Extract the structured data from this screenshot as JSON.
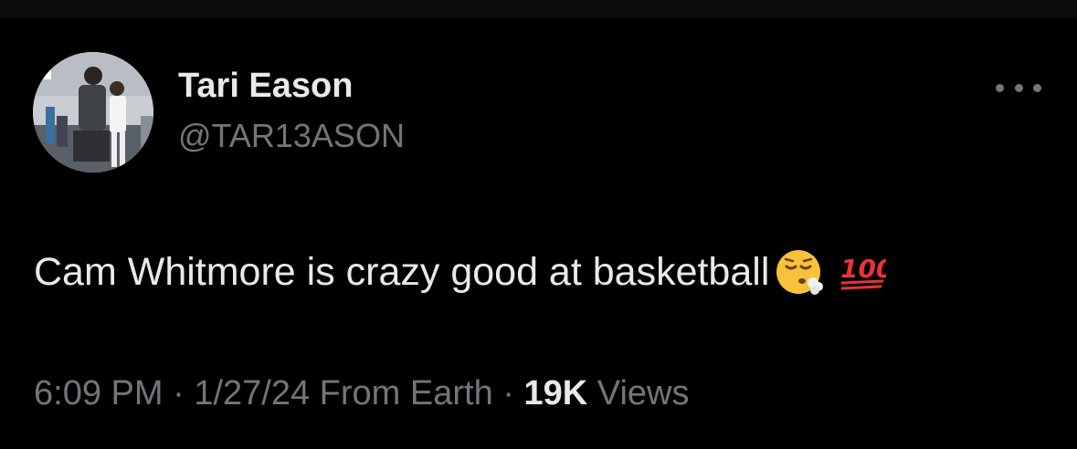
{
  "tweet": {
    "author": {
      "display_name": "Tari Eason",
      "handle": "@TAR13ASON",
      "avatar_icon": "avatar-photo"
    },
    "more_icon": "more-horizontal-icon",
    "text": "Cam Whitmore is crazy good at basketball",
    "emojis": [
      "face-exhaling-emoji",
      "hundred-points-emoji"
    ],
    "meta": {
      "time": "6:09 PM",
      "separator": "·",
      "date": "1/27/24",
      "source": "From Earth",
      "view_count": "19K",
      "views_label": "Views"
    }
  },
  "colors": {
    "background": "#000000",
    "primary_text": "#e7e9ea",
    "secondary_text": "#71767b",
    "hundred_red": "#e8323a"
  }
}
